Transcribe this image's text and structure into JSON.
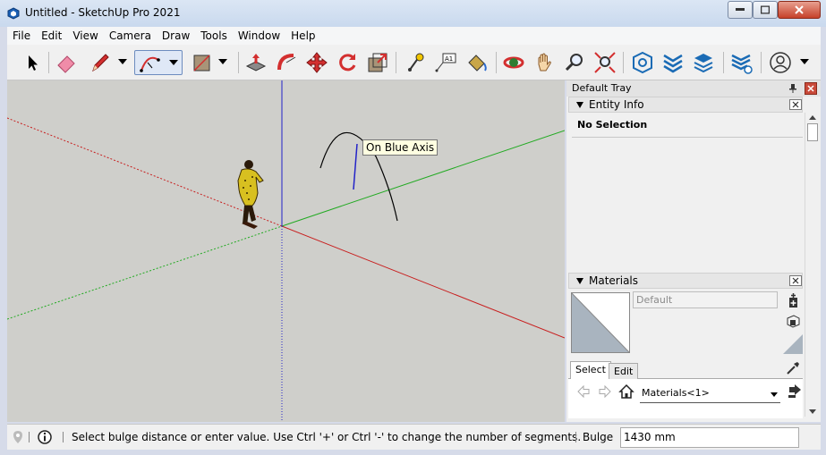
{
  "window": {
    "title": "Untitled - SketchUp Pro 2021"
  },
  "menu": [
    "File",
    "Edit",
    "View",
    "Camera",
    "Draw",
    "Tools",
    "Window",
    "Help"
  ],
  "toolbar": {
    "tools": [
      "select-tool",
      "eraser-tool",
      "line-tool",
      "arc-tool",
      "rectangle-tool",
      "push-pull-tool",
      "follow-me-tool",
      "move-tool",
      "rotate-tool",
      "scale-tool",
      "tape-measure-tool",
      "text-tool",
      "paint-bucket-tool",
      "orbit-tool",
      "pan-tool",
      "zoom-tool",
      "zoom-extents-tool",
      "warehouse-tool",
      "extension-tool",
      "components-tool",
      "layers-tool",
      "profile-tool"
    ],
    "text_tool_label": "A1"
  },
  "viewport": {
    "tooltip": "On Blue Axis",
    "colors": {
      "red_axis": "#c81e1e",
      "green_axis": "#22aa22",
      "blue_axis": "#2222c8",
      "background": "#cfcfcb"
    }
  },
  "tray": {
    "title": "Default Tray",
    "entity_info": {
      "title": "Entity Info",
      "selection": "No Selection"
    },
    "materials": {
      "title": "Materials",
      "name_value": "Default",
      "tabs": [
        "Select",
        "Edit"
      ],
      "selected_tab": "Select",
      "library": "Materials<1>"
    }
  },
  "status": {
    "message": "Select bulge distance or enter value. Use Ctrl '+' or Ctrl '-' to change the number of segments.",
    "vcb_label": "Bulge",
    "vcb_value": "1430 mm"
  }
}
